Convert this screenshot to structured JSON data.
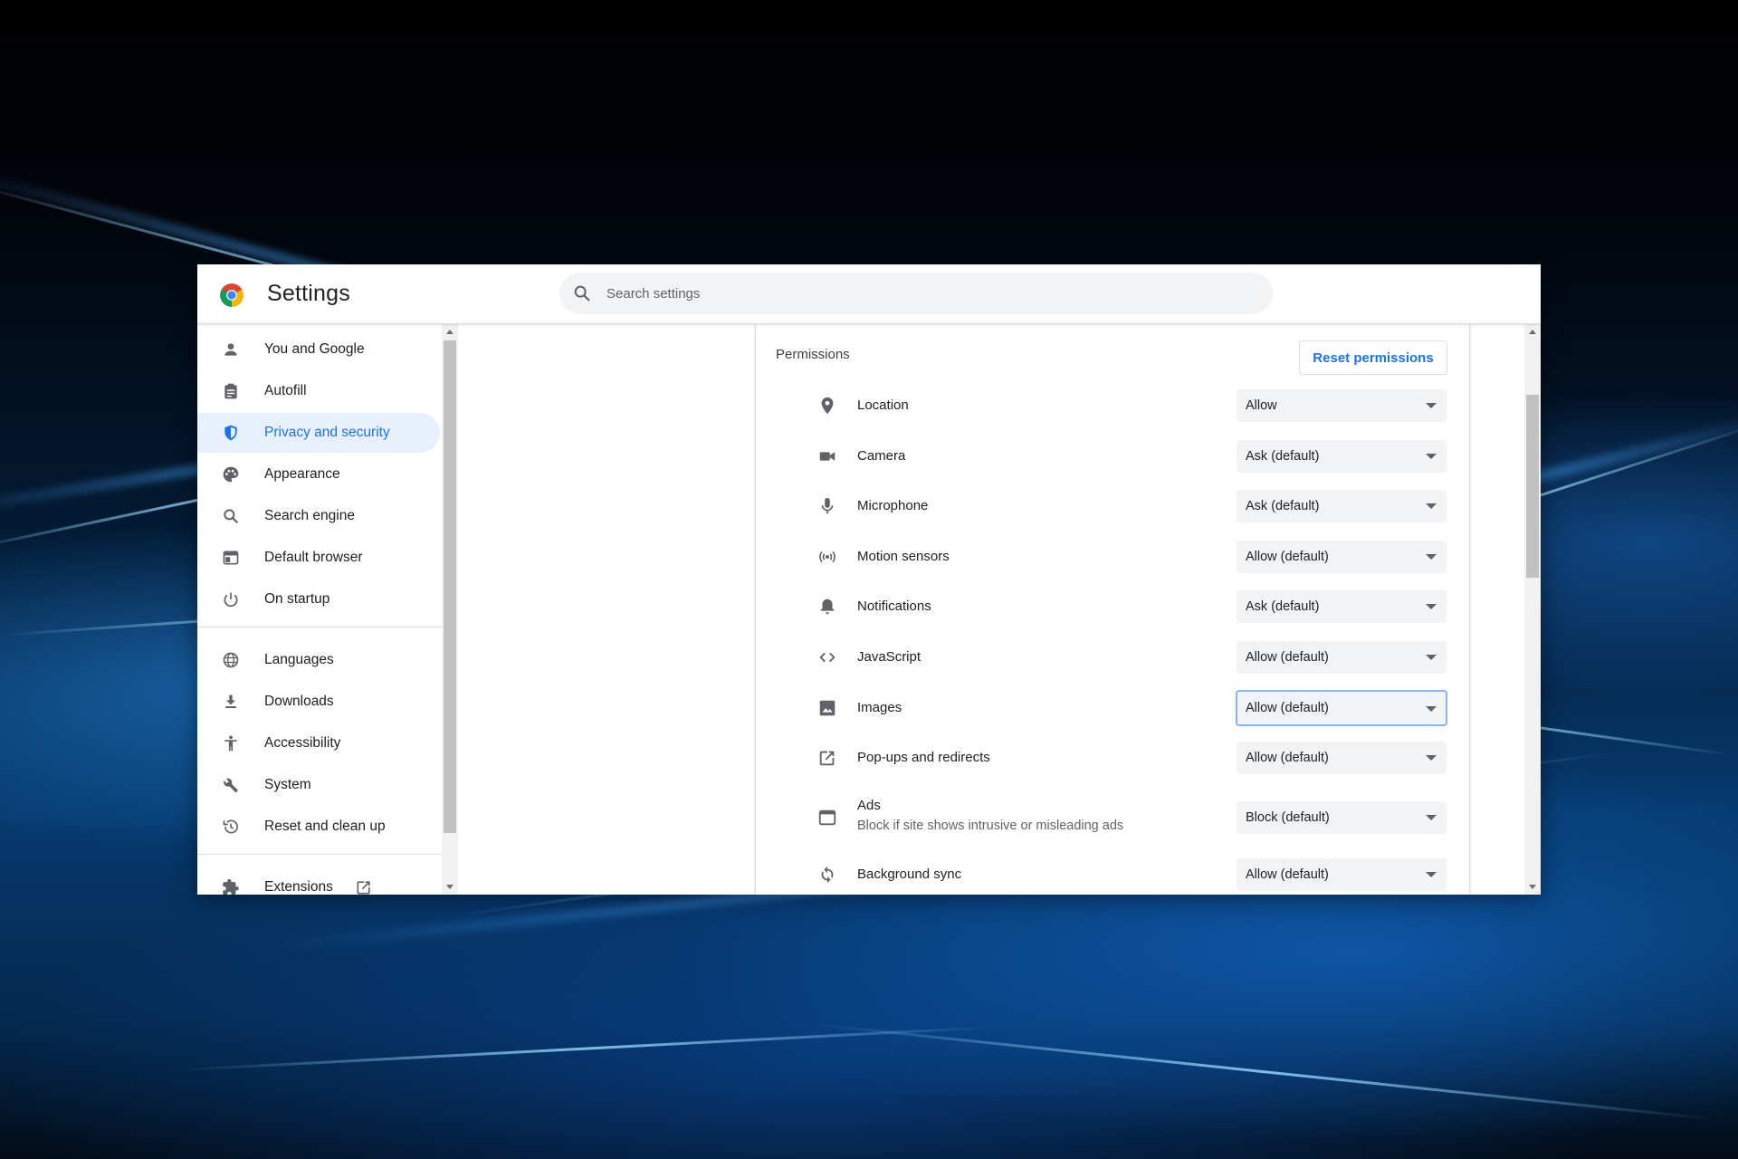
{
  "app": {
    "title": "Settings"
  },
  "search": {
    "placeholder": "Search settings",
    "value": ""
  },
  "sidebar": {
    "items": [
      {
        "label": "You and Google",
        "icon": "person-icon"
      },
      {
        "label": "Autofill",
        "icon": "clipboard-icon"
      },
      {
        "label": "Privacy and security",
        "icon": "shield-icon",
        "active": true
      },
      {
        "label": "Appearance",
        "icon": "palette-icon"
      },
      {
        "label": "Search engine",
        "icon": "search-icon"
      },
      {
        "label": "Default browser",
        "icon": "browser-window-icon"
      },
      {
        "label": "On startup",
        "icon": "power-icon"
      },
      {
        "label": "Languages",
        "icon": "globe-icon"
      },
      {
        "label": "Downloads",
        "icon": "download-icon"
      },
      {
        "label": "Accessibility",
        "icon": "accessibility-icon"
      },
      {
        "label": "System",
        "icon": "wrench-icon"
      },
      {
        "label": "Reset and clean up",
        "icon": "history-icon"
      },
      {
        "label": "Extensions",
        "icon": "puzzle-icon"
      }
    ]
  },
  "permissions": {
    "heading": "Permissions",
    "reset_label": "Reset permissions",
    "rows": [
      {
        "label": "Location",
        "value": "Allow",
        "icon": "location-pin-icon"
      },
      {
        "label": "Camera",
        "value": "Ask (default)",
        "icon": "camera-icon"
      },
      {
        "label": "Microphone",
        "value": "Ask (default)",
        "icon": "microphone-icon"
      },
      {
        "label": "Motion sensors",
        "value": "Allow (default)",
        "icon": "sensors-icon"
      },
      {
        "label": "Notifications",
        "value": "Ask (default)",
        "icon": "bell-icon"
      },
      {
        "label": "JavaScript",
        "value": "Allow (default)",
        "icon": "code-icon"
      },
      {
        "label": "Images",
        "value": "Allow (default)",
        "icon": "image-icon",
        "focused": true
      },
      {
        "label": "Pop-ups and redirects",
        "value": "Allow (default)",
        "icon": "open-in-new-icon"
      },
      {
        "label": "Ads",
        "sublabel": "Block if site shows intrusive or misleading ads",
        "value": "Block (default)",
        "icon": "ads-window-icon"
      },
      {
        "label": "Background sync",
        "value": "Allow (default)",
        "icon": "sync-icon"
      }
    ]
  },
  "colors": {
    "accent": "#1a73e8",
    "active_bg": "#e8f0fe",
    "select_bg": "#f1f3f4",
    "icon": "#5f6368"
  }
}
